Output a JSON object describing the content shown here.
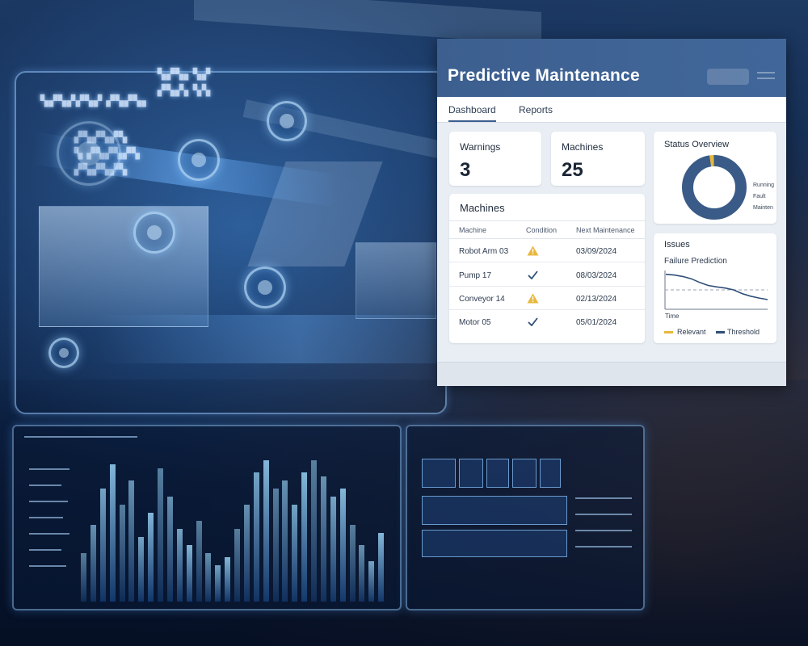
{
  "app": {
    "title": "Predictive Maintenance"
  },
  "tabs": [
    {
      "label": "Dashboard",
      "active": true
    },
    {
      "label": "Reports",
      "active": false
    }
  ],
  "kpis": {
    "warnings": {
      "label": "Warnings",
      "value": "3"
    },
    "machines": {
      "label": "Machines",
      "value": "25"
    }
  },
  "machines_table": {
    "title": "Machines",
    "columns": [
      "Machine",
      "Condition",
      "Next Maintenance"
    ],
    "rows": [
      {
        "machine": "Robot Arm 03",
        "condition": "warning",
        "next": "03/09/2024"
      },
      {
        "machine": "Pump 17",
        "condition": "ok",
        "next": "08/03/2024"
      },
      {
        "machine": "Conveyor 14",
        "condition": "warning",
        "next": "02/13/2024"
      },
      {
        "machine": "Motor 05",
        "condition": "ok",
        "next": "05/01/2024"
      }
    ]
  },
  "status_overview": {
    "title": "Status Overview",
    "legend": [
      "Running",
      "Fault",
      "Mainten"
    ]
  },
  "issues": {
    "title": "Issues",
    "chart_title": "Failure Prediction",
    "xlabel": "Time",
    "legend": [
      "Relevant",
      "Threshold"
    ]
  },
  "chart_data": [
    {
      "type": "pie",
      "title": "Status Overview",
      "categories": [
        "Running",
        "Fault",
        "Mainten"
      ],
      "values": [
        98,
        2,
        0
      ]
    },
    {
      "type": "line",
      "title": "Failure Prediction",
      "xlabel": "Time",
      "ylabel": "",
      "x": [
        0,
        1,
        2,
        3,
        4,
        5,
        6,
        7,
        8,
        9,
        10,
        11,
        12
      ],
      "series": [
        {
          "name": "Relevant",
          "values": [
            0.92,
            0.9,
            0.86,
            0.8,
            0.7,
            0.62,
            0.58,
            0.55,
            0.5,
            0.4,
            0.33,
            0.28,
            0.24
          ]
        }
      ],
      "threshold": 0.5,
      "ylim": [
        0,
        1
      ]
    }
  ],
  "colors": {
    "header": "#3c5f8f",
    "accent": "#3c5f8f",
    "warning": "#e8b83c",
    "ok": "#2f4f78",
    "donut_main": "#3a5b87",
    "donut_fault": "#e8b83c"
  },
  "icons": {
    "warning": "warning-triangle-icon",
    "ok": "checkmark-icon",
    "menu": "hamburger-menu-icon"
  }
}
